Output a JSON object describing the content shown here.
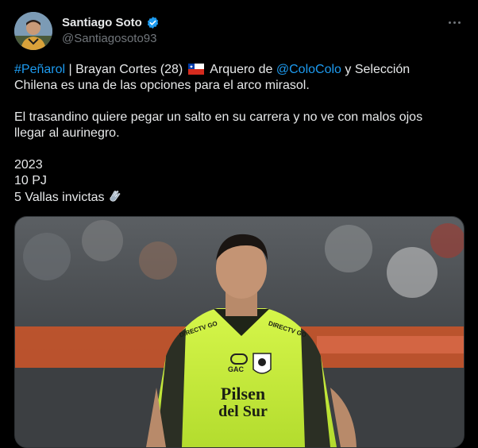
{
  "author": {
    "display_name": "Santiago Soto",
    "handle": "@Santiagosoto93"
  },
  "tweet": {
    "line1": {
      "hashtag": "#Peñarol",
      "text_a": " | Brayan Cortes (28) ",
      "text_b": " Arquero de ",
      "mention": "@ColoColo",
      "text_c": " y Selección"
    },
    "line2": "Chilena es una de las opciones para el arco mirasol.",
    "paragraph2_line1": "El trasandino quiere pegar un salto en su carrera y no ve con malos ojos",
    "paragraph2_line2": "llegar al aurinegro.",
    "stat_year": "2023",
    "stat_games": "10 PJ",
    "stat_clean_sheets": "5 Vallas invictas"
  },
  "media": {
    "jersey_sponsor_line1": "Pilsen",
    "jersey_sponsor_line2": "del Sur",
    "jersey_brand": "GAC",
    "jersey_shoulder_left": "DIRECTV GO",
    "jersey_shoulder_right": "DIRECTV GO"
  },
  "icons": {
    "verified": "verified-badge-icon",
    "more": "more-options-icon",
    "flag": "chile-flag-icon",
    "hand": "clapping-hands-icon"
  },
  "colors": {
    "background": "#000000",
    "text": "#e7e9ea",
    "secondary": "#71767b",
    "link": "#1d9bf0",
    "jersey": "#c8f03c"
  }
}
